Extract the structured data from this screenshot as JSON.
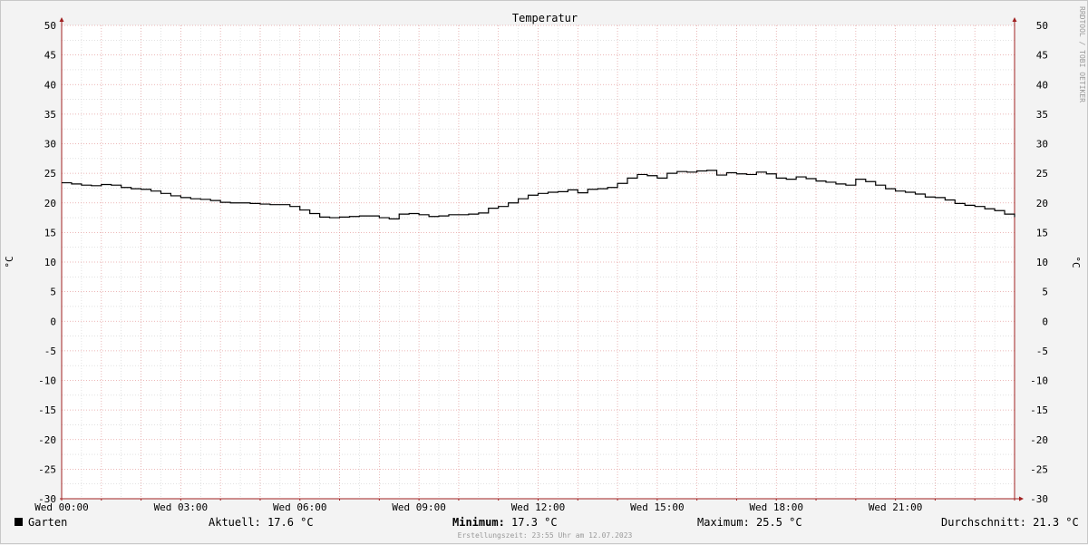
{
  "chart_data": {
    "type": "line",
    "title": "Temperatur",
    "ylabel_left": "°C",
    "ylabel_right": "°C",
    "vertical_label": "RRDTOOL / TOBI OETIKER",
    "ylim": [
      -30,
      50
    ],
    "yticks": [
      50,
      45,
      40,
      35,
      30,
      25,
      20,
      15,
      10,
      5,
      0,
      -5,
      -10,
      -15,
      -20,
      -25,
      -30
    ],
    "xlim": [
      0,
      24
    ],
    "xticks": [
      {
        "value": 0,
        "label": "Wed 00:00"
      },
      {
        "value": 3,
        "label": "Wed 03:00"
      },
      {
        "value": 6,
        "label": "Wed 06:00"
      },
      {
        "value": 9,
        "label": "Wed 09:00"
      },
      {
        "value": 12,
        "label": "Wed 12:00"
      },
      {
        "value": 15,
        "label": "Wed 15:00"
      },
      {
        "value": 18,
        "label": "Wed 18:00"
      },
      {
        "value": 21,
        "label": "Wed 21:00"
      }
    ],
    "grid": true,
    "colors": {
      "background": "#f3f3f3",
      "plot": "#ffffff",
      "major_grid": "#e6a0a0",
      "minor_grid": "#d0d0d0",
      "line": "#000000",
      "axis": "#a02020"
    },
    "series": [
      {
        "name": "Garten",
        "x": [
          0,
          0.25,
          0.5,
          0.75,
          1.0,
          1.25,
          1.5,
          1.75,
          2.0,
          2.25,
          2.5,
          2.75,
          3.0,
          3.25,
          3.5,
          3.75,
          4.0,
          4.25,
          4.5,
          4.75,
          5.0,
          5.25,
          5.5,
          5.75,
          6.0,
          6.25,
          6.5,
          6.75,
          7.0,
          7.25,
          7.5,
          7.75,
          8.0,
          8.25,
          8.5,
          8.75,
          9.0,
          9.25,
          9.5,
          9.75,
          10.0,
          10.25,
          10.5,
          10.75,
          11.0,
          11.25,
          11.5,
          11.75,
          12.0,
          12.25,
          12.5,
          12.75,
          13.0,
          13.25,
          13.5,
          13.75,
          14.0,
          14.25,
          14.5,
          14.75,
          15.0,
          15.25,
          15.5,
          15.75,
          16.0,
          16.25,
          16.5,
          16.75,
          17.0,
          17.25,
          17.5,
          17.75,
          18.0,
          18.25,
          18.5,
          18.75,
          19.0,
          19.25,
          19.5,
          19.75,
          20.0,
          20.25,
          20.5,
          20.75,
          21.0,
          21.25,
          21.5,
          21.75,
          22.0,
          22.25,
          22.5,
          22.75,
          23.0,
          23.25,
          23.5,
          23.75,
          24.0
        ],
        "y": [
          23.4,
          23.2,
          23.0,
          22.9,
          23.1,
          23.0,
          22.6,
          22.4,
          22.3,
          22.0,
          21.6,
          21.2,
          20.9,
          20.7,
          20.6,
          20.4,
          20.1,
          20.0,
          20.0,
          19.9,
          19.8,
          19.7,
          19.7,
          19.4,
          18.8,
          18.2,
          17.6,
          17.5,
          17.6,
          17.7,
          17.8,
          17.8,
          17.5,
          17.3,
          18.1,
          18.2,
          18.0,
          17.7,
          17.8,
          18.0,
          18.0,
          18.1,
          18.3,
          19.1,
          19.4,
          20.0,
          20.7,
          21.3,
          21.6,
          21.8,
          21.9,
          22.2,
          21.7,
          22.3,
          22.4,
          22.6,
          23.3,
          24.2,
          24.8,
          24.6,
          24.2,
          25.0,
          25.3,
          25.2,
          25.4,
          25.5,
          24.7,
          25.1,
          24.9,
          24.8,
          25.2,
          24.9,
          24.2,
          24.0,
          24.4,
          24.1,
          23.7,
          23.5,
          23.2,
          23.0,
          24.0,
          23.6,
          23.0,
          22.4,
          22.0,
          21.8,
          21.5,
          21.0,
          20.9,
          20.5,
          19.9,
          19.6,
          19.4,
          19.0,
          18.7,
          18.1,
          17.6
        ]
      }
    ]
  },
  "legend": {
    "series_name": "Garten",
    "aktuell": "Aktuell: 17.6 °C",
    "minimum_label": "Minimum:",
    "minimum_value": " 17.3 °C",
    "maximum": "Maximum: 25.5 °C",
    "durchschnitt": "Durchschnitt: 21.3 °C"
  },
  "footer": "Erstellungszeit: 23:55 Uhr am 12.07.2023"
}
